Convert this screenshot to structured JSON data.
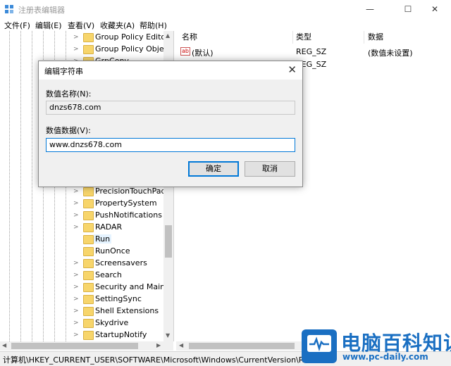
{
  "window": {
    "title": "注册表编辑器",
    "buttons": {
      "minimize": "—",
      "maximize": "☐",
      "close": "✕"
    }
  },
  "menu": [
    "文件(F)",
    "编辑(E)",
    "查看(V)",
    "收藏夹(A)",
    "帮助(H)"
  ],
  "tree": {
    "items": [
      {
        "label": "Group Policy Editor",
        "expandable": true
      },
      {
        "label": "Group Policy Objec",
        "expandable": true
      },
      {
        "label": "GrpConv",
        "expandable": true
      },
      {
        "label": "PrecisionTouchPad",
        "expandable": true
      },
      {
        "label": "PropertySystem",
        "expandable": true
      },
      {
        "label": "PushNotifications",
        "expandable": true
      },
      {
        "label": "RADAR",
        "expandable": true
      },
      {
        "label": "Run",
        "expandable": false,
        "selected": true
      },
      {
        "label": "RunOnce",
        "expandable": false
      },
      {
        "label": "Screensavers",
        "expandable": true
      },
      {
        "label": "Search",
        "expandable": true
      },
      {
        "label": "Security and Mainte",
        "expandable": true
      },
      {
        "label": "SettingSync",
        "expandable": true
      },
      {
        "label": "Shell Extensions",
        "expandable": true
      },
      {
        "label": "Skydrive",
        "expandable": true
      },
      {
        "label": "StartupNotify",
        "expandable": true
      }
    ]
  },
  "list": {
    "columns": [
      "名称",
      "类型",
      "数据"
    ],
    "rows": [
      {
        "name": "(默认)",
        "type": "REG_SZ",
        "data": "(数值未设置)"
      },
      {
        "name": "",
        "type": "REG_SZ",
        "data": ""
      }
    ]
  },
  "statusbar": {
    "path": "计算机\\HKEY_CURRENT_USER\\SOFTWARE\\Microsoft\\Windows\\CurrentVersion\\Run"
  },
  "dialog": {
    "title": "编辑字符串",
    "name_label": "数值名称(N):",
    "name_value": "dnzs678.com",
    "data_label": "数值数据(V):",
    "data_value": "www.dnzs678.com",
    "ok_label": "确定",
    "cancel_label": "取消"
  },
  "watermark": {
    "text": "电脑百科知识",
    "url": "www.pc-daily.com"
  },
  "colors": {
    "accent": "#0078d7",
    "watermark": "#1a6fc2",
    "folder": "#f7d56b"
  }
}
